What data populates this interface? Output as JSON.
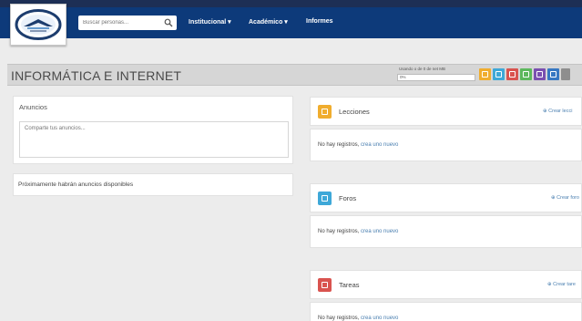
{
  "header": {
    "search": {
      "placeholder": "Buscar personas..."
    },
    "nav": [
      {
        "label": "Institucional ▾"
      },
      {
        "label": "Académico ▾"
      },
      {
        "label": "Informes"
      }
    ]
  },
  "title_bar": {
    "course_title": "INFORMÁTICA E INTERNET",
    "storage_text": "Usando o de 0 de net MB",
    "storage_percent": "0%",
    "storage_fraction": 0,
    "tool_colors": [
      "#f0ad2e",
      "#3ea8d8",
      "#d9534f",
      "#5cb85c",
      "#7a4fb0",
      "#3778c2",
      "#8e8e8e"
    ]
  },
  "anuncios": {
    "title": "Anuncios",
    "placeholder": "Comparte tus anuncios..."
  },
  "proximos": {
    "text": "Próximamente habrán anuncios disponibles"
  },
  "sections": [
    {
      "title": "Lecciones",
      "action": "⊕ Crear lecci",
      "empty_text": "No hay registros, ",
      "empty_link": "crea uno nuevo",
      "color": "#f0ad2e"
    },
    {
      "title": "Foros",
      "action": "⊕ Crear foro",
      "empty_text": "No hay registros, ",
      "empty_link": "crea uno nuevo",
      "color": "#3ea8d8"
    },
    {
      "title": "Tareas",
      "action": "⊕ Crear tare",
      "empty_text": "No hay registros, ",
      "empty_link": "crea uno nuevo",
      "color": "#d9534f"
    }
  ]
}
